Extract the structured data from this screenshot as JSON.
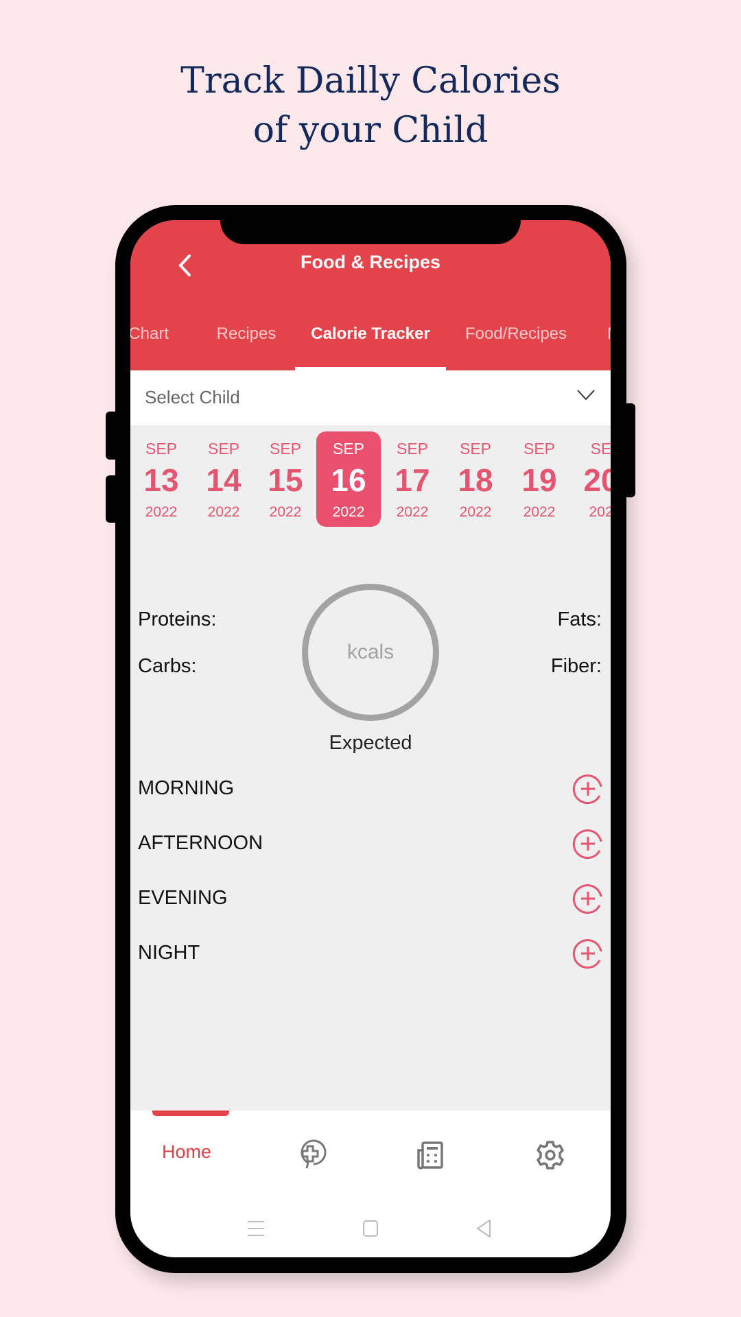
{
  "headline": {
    "line1": "Track Dailly Calories",
    "line2": "of your Child"
  },
  "header": {
    "title": "Food & Recipes",
    "back_icon": "chevron-left-icon"
  },
  "tabs": [
    {
      "label": "t Chart"
    },
    {
      "label": "Recipes"
    },
    {
      "label": "Calorie Tracker",
      "active": true
    },
    {
      "label": "Food/Recipes"
    },
    {
      "label": "M"
    }
  ],
  "select_child": {
    "placeholder": "Select Child"
  },
  "dates": [
    {
      "month": "SEP",
      "day": "13",
      "year": "2022"
    },
    {
      "month": "SEP",
      "day": "14",
      "year": "2022"
    },
    {
      "month": "SEP",
      "day": "15",
      "year": "2022"
    },
    {
      "month": "SEP",
      "day": "16",
      "year": "2022",
      "selected": true
    },
    {
      "month": "SEP",
      "day": "17",
      "year": "2022"
    },
    {
      "month": "SEP",
      "day": "18",
      "year": "2022"
    },
    {
      "month": "SEP",
      "day": "19",
      "year": "2022"
    },
    {
      "month": "SE",
      "day": "20",
      "year": "202"
    }
  ],
  "nutrients": {
    "proteins": "Proteins:",
    "carbs": "Carbs:",
    "fats": "Fats:",
    "fiber": "Fiber:"
  },
  "calories": {
    "unit": "kcals",
    "label": "Expected"
  },
  "meals": [
    {
      "label": "MORNING"
    },
    {
      "label": "AFTERNOON"
    },
    {
      "label": "EVENING"
    },
    {
      "label": "NIGHT"
    }
  ],
  "bottom_nav": {
    "home": "Home",
    "icons": [
      "medical-chat-icon",
      "newspaper-icon",
      "gear-icon"
    ]
  },
  "colors": {
    "header": "#e3434a",
    "accent": "#e8506e",
    "headline": "#14295a"
  }
}
